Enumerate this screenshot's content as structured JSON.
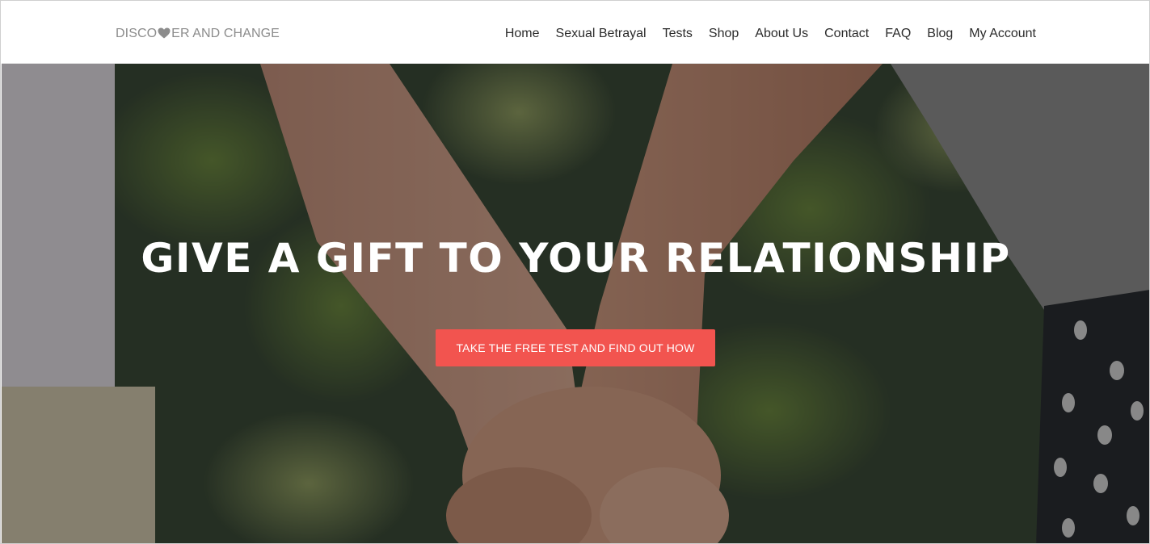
{
  "header": {
    "logo": {
      "text_before": "DISCO",
      "text_after": "ER AND CHANGE",
      "icon": "heart-icon"
    },
    "nav": [
      {
        "label": "Home"
      },
      {
        "label": "Sexual Betrayal"
      },
      {
        "label": "Tests"
      },
      {
        "label": "Shop"
      },
      {
        "label": "About Us"
      },
      {
        "label": "Contact"
      },
      {
        "label": "FAQ"
      },
      {
        "label": "Blog"
      },
      {
        "label": "My Account"
      }
    ]
  },
  "hero": {
    "headline": "GIVE A GIFT TO YOUR RELATIONSHIP",
    "cta_label": "TAKE THE FREE TEST AND FIND OUT HOW"
  },
  "colors": {
    "accent": "#f2544f",
    "logo_text": "#8c8c8c",
    "nav_text": "#2b2b2b"
  }
}
